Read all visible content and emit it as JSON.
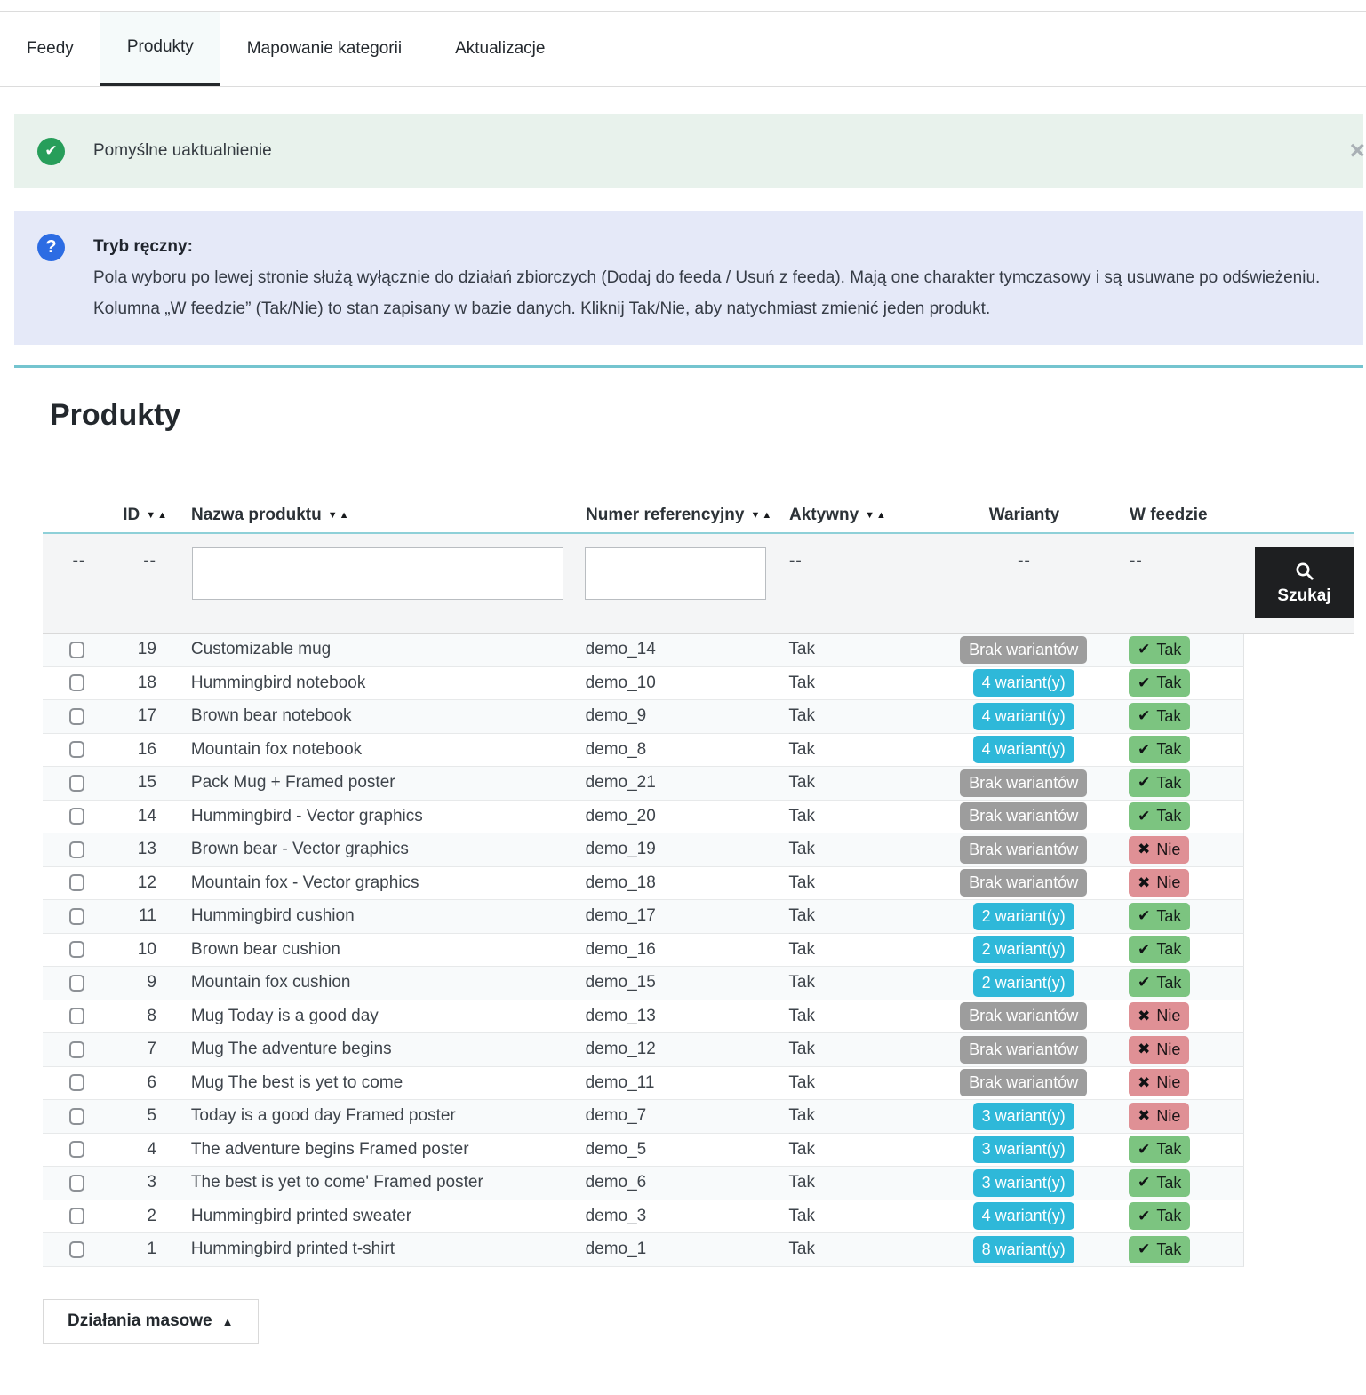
{
  "tabs": [
    {
      "label": "Feedy",
      "active": false
    },
    {
      "label": "Produkty",
      "active": true
    },
    {
      "label": "Mapowanie kategorii",
      "active": false
    },
    {
      "label": "Aktualizacje",
      "active": false
    }
  ],
  "alert": {
    "message": "Pomyślne uaktualnienie",
    "close": "×"
  },
  "info": {
    "title": "Tryb ręczny:",
    "line1": "Pola wyboru po lewej stronie służą wyłącznie do działań zbiorczych (Dodaj do feeda / Usuń z feeda). Mają one charakter tymczasowy i są usuwane po odświeżeniu.",
    "line2": "Kolumna „W feedzie” (Tak/Nie) to stan zapisany w bazie danych. Kliknij Tak/Nie, aby natychmiast zmienić jeden produkt."
  },
  "panel": {
    "title": "Produkty"
  },
  "icons": {
    "success_check": "✔",
    "help": "?",
    "sort": "▼▲",
    "check": "✔",
    "cross": "✖",
    "caret_up": "▲"
  },
  "table": {
    "headers": [
      {
        "label": "ID",
        "sortable": true
      },
      {
        "label": "Nazwa produktu",
        "sortable": true
      },
      {
        "label": "Numer referencyjny",
        "sortable": true
      },
      {
        "label": "Aktywny",
        "sortable": true
      },
      {
        "label": "Warianty",
        "sortable": false
      },
      {
        "label": "W feedzie",
        "sortable": false
      }
    ],
    "filter_dash": "--",
    "search_label": "Szukaj",
    "name_filter_value": "",
    "reference_filter_value": "",
    "rows": [
      {
        "id": "19",
        "name": "Customizable mug",
        "reference": "demo_14",
        "active": "Tak",
        "variants_label": "Brak wariantów",
        "variants_kind": "none",
        "feed_label": "Tak",
        "feed_state": "yes"
      },
      {
        "id": "18",
        "name": "Hummingbird notebook",
        "reference": "demo_10",
        "active": "Tak",
        "variants_label": "4 wariant(y)",
        "variants_kind": "some",
        "feed_label": "Tak",
        "feed_state": "yes"
      },
      {
        "id": "17",
        "name": "Brown bear notebook",
        "reference": "demo_9",
        "active": "Tak",
        "variants_label": "4 wariant(y)",
        "variants_kind": "some",
        "feed_label": "Tak",
        "feed_state": "yes"
      },
      {
        "id": "16",
        "name": "Mountain fox notebook",
        "reference": "demo_8",
        "active": "Tak",
        "variants_label": "4 wariant(y)",
        "variants_kind": "some",
        "feed_label": "Tak",
        "feed_state": "yes"
      },
      {
        "id": "15",
        "name": "Pack Mug + Framed poster",
        "reference": "demo_21",
        "active": "Tak",
        "variants_label": "Brak wariantów",
        "variants_kind": "none",
        "feed_label": "Tak",
        "feed_state": "yes"
      },
      {
        "id": "14",
        "name": "Hummingbird - Vector graphics",
        "reference": "demo_20",
        "active": "Tak",
        "variants_label": "Brak wariantów",
        "variants_kind": "none",
        "feed_label": "Tak",
        "feed_state": "yes"
      },
      {
        "id": "13",
        "name": "Brown bear - Vector graphics",
        "reference": "demo_19",
        "active": "Tak",
        "variants_label": "Brak wariantów",
        "variants_kind": "none",
        "feed_label": "Nie",
        "feed_state": "no"
      },
      {
        "id": "12",
        "name": "Mountain fox - Vector graphics",
        "reference": "demo_18",
        "active": "Tak",
        "variants_label": "Brak wariantów",
        "variants_kind": "none",
        "feed_label": "Nie",
        "feed_state": "no"
      },
      {
        "id": "11",
        "name": "Hummingbird cushion",
        "reference": "demo_17",
        "active": "Tak",
        "variants_label": "2 wariant(y)",
        "variants_kind": "some",
        "feed_label": "Tak",
        "feed_state": "yes"
      },
      {
        "id": "10",
        "name": "Brown bear cushion",
        "reference": "demo_16",
        "active": "Tak",
        "variants_label": "2 wariant(y)",
        "variants_kind": "some",
        "feed_label": "Tak",
        "feed_state": "yes"
      },
      {
        "id": "9",
        "name": "Mountain fox cushion",
        "reference": "demo_15",
        "active": "Tak",
        "variants_label": "2 wariant(y)",
        "variants_kind": "some",
        "feed_label": "Tak",
        "feed_state": "yes"
      },
      {
        "id": "8",
        "name": "Mug Today is a good day",
        "reference": "demo_13",
        "active": "Tak",
        "variants_label": "Brak wariantów",
        "variants_kind": "none",
        "feed_label": "Nie",
        "feed_state": "no"
      },
      {
        "id": "7",
        "name": "Mug The adventure begins",
        "reference": "demo_12",
        "active": "Tak",
        "variants_label": "Brak wariantów",
        "variants_kind": "none",
        "feed_label": "Nie",
        "feed_state": "no"
      },
      {
        "id": "6",
        "name": "Mug The best is yet to come",
        "reference": "demo_11",
        "active": "Tak",
        "variants_label": "Brak wariantów",
        "variants_kind": "none",
        "feed_label": "Nie",
        "feed_state": "no"
      },
      {
        "id": "5",
        "name": "Today is a good day Framed poster",
        "reference": "demo_7",
        "active": "Tak",
        "variants_label": "3 wariant(y)",
        "variants_kind": "some",
        "feed_label": "Nie",
        "feed_state": "no"
      },
      {
        "id": "4",
        "name": "The adventure begins Framed poster",
        "reference": "demo_5",
        "active": "Tak",
        "variants_label": "3 wariant(y)",
        "variants_kind": "some",
        "feed_label": "Tak",
        "feed_state": "yes"
      },
      {
        "id": "3",
        "name": "The best is yet to come' Framed poster",
        "reference": "demo_6",
        "active": "Tak",
        "variants_label": "3 wariant(y)",
        "variants_kind": "some",
        "feed_label": "Tak",
        "feed_state": "yes"
      },
      {
        "id": "2",
        "name": "Hummingbird printed sweater",
        "reference": "demo_3",
        "active": "Tak",
        "variants_label": "4 wariant(y)",
        "variants_kind": "some",
        "feed_label": "Tak",
        "feed_state": "yes"
      },
      {
        "id": "1",
        "name": "Hummingbird printed t-shirt",
        "reference": "demo_1",
        "active": "Tak",
        "variants_label": "8 wariant(y)",
        "variants_kind": "some",
        "feed_label": "Tak",
        "feed_state": "yes"
      }
    ]
  },
  "bulk": {
    "label": "Działania masowe"
  }
}
